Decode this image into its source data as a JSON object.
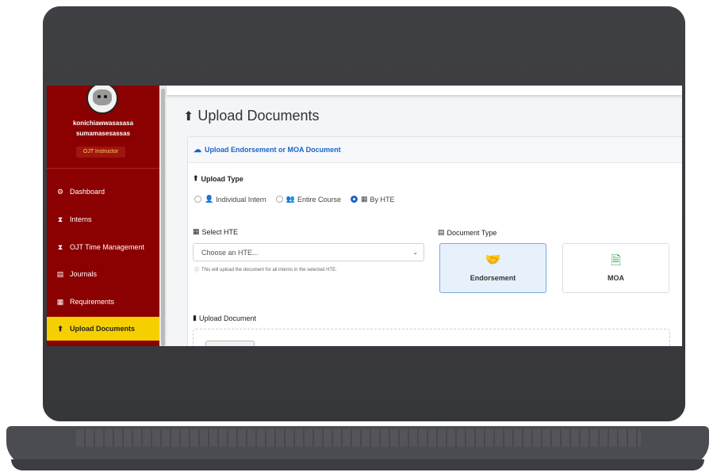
{
  "sidebar": {
    "username": "konichiawwasasasa sumamasesassas",
    "role": "OJT Instructor",
    "items": [
      {
        "label": "Dashboard",
        "icon": "dashboard-icon",
        "glyph": "⚙"
      },
      {
        "label": "Interns",
        "icon": "hourglass-icon",
        "glyph": "⧗"
      },
      {
        "label": "OJT Time Management",
        "icon": "hourglass-icon",
        "glyph": "⧗"
      },
      {
        "label": "Journals",
        "icon": "journal-icon",
        "glyph": "▤"
      },
      {
        "label": "Requirements",
        "icon": "file-icon",
        "glyph": "▦"
      },
      {
        "label": "Upload Documents",
        "icon": "upload-icon",
        "glyph": "⬆"
      }
    ]
  },
  "page": {
    "title": "Upload Documents"
  },
  "card": {
    "header": "Upload Endorsement or MOA Document",
    "upload_type_label": "Upload Type",
    "radio_options": [
      "Individual Intern",
      "Entire Course",
      "By HTE"
    ],
    "selected_option": "By HTE",
    "select_hte_label": "Select HTE",
    "select_hte_value": "Choose an HTE...",
    "help_text": "This will upload the document for all interns in the selected HTE.",
    "document_type_label": "Document Type",
    "doc_types": [
      {
        "label": "Endorsement",
        "selected": true,
        "color": "#1a64c9"
      },
      {
        "label": "MOA",
        "selected": false,
        "color": "#2e9b4a"
      }
    ],
    "upload_document_label": "Upload Document"
  },
  "colors": {
    "sidebar_bg": "#8b0000",
    "active_item": "#f6cf00",
    "accent": "#1a64c9",
    "laptop_body": "#3a3b3f"
  }
}
